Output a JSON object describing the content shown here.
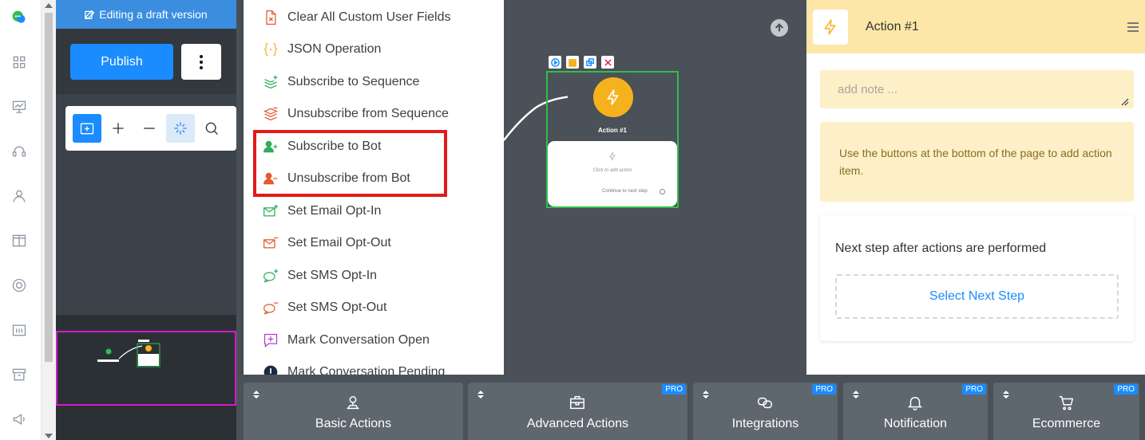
{
  "left_panel": {
    "draft_banner": "Editing a draft version",
    "publish_label": "Publish"
  },
  "dropdown": {
    "items": [
      {
        "label": "Clear All Custom User Fields",
        "icon": "file-x-icon",
        "color": "#e25b2b"
      },
      {
        "label": "JSON Operation",
        "icon": "braces-icon",
        "color": "#f6b21c"
      },
      {
        "label": "Subscribe to Sequence",
        "icon": "layers-plus-icon",
        "color": "#2fae5e"
      },
      {
        "label": "Unsubscribe from Sequence",
        "icon": "layers-minus-icon",
        "color": "#e25b2b"
      },
      {
        "label": "Subscribe to Bot",
        "icon": "user-plus-icon",
        "color": "#2fae5e"
      },
      {
        "label": "Unsubscribe from Bot",
        "icon": "user-minus-icon",
        "color": "#e25b2b"
      },
      {
        "label": "Set Email Opt-In",
        "icon": "mail-plus-icon",
        "color": "#2fae5e"
      },
      {
        "label": "Set Email Opt-Out",
        "icon": "mail-minus-icon",
        "color": "#e25b2b"
      },
      {
        "label": "Set SMS Opt-In",
        "icon": "sms-plus-icon",
        "color": "#2fae5e"
      },
      {
        "label": "Set SMS Opt-Out",
        "icon": "sms-minus-icon",
        "color": "#e25b2b"
      },
      {
        "label": "Mark Conversation Open",
        "icon": "message-plus-icon",
        "color": "#b03bd1"
      },
      {
        "label": "Mark Conversation Pending",
        "icon": "alert-circle-icon",
        "color": "#1e2a44"
      }
    ]
  },
  "canvas": {
    "node_title": "Action #1",
    "node_hint": "Click to add action",
    "node_next": "Continue to next step"
  },
  "right_panel": {
    "title": "Action #1",
    "note_placeholder": "add note ...",
    "info": "Use the buttons at the bottom of the page to add action item.",
    "next_label": "Next step after actions are performed",
    "select_next": "Select Next Step"
  },
  "bottom_tabs": [
    {
      "label": "Basic Actions",
      "pro": ""
    },
    {
      "label": "Advanced Actions",
      "pro": "PRO"
    },
    {
      "label": "Integrations",
      "pro": "PRO"
    },
    {
      "label": "Notification",
      "pro": "PRO"
    },
    {
      "label": "Ecommerce",
      "pro": "PRO"
    }
  ],
  "colors": {
    "accent": "#1a8cff",
    "action_yellow": "#f6b21c",
    "highlight_red": "#e11b1b"
  }
}
